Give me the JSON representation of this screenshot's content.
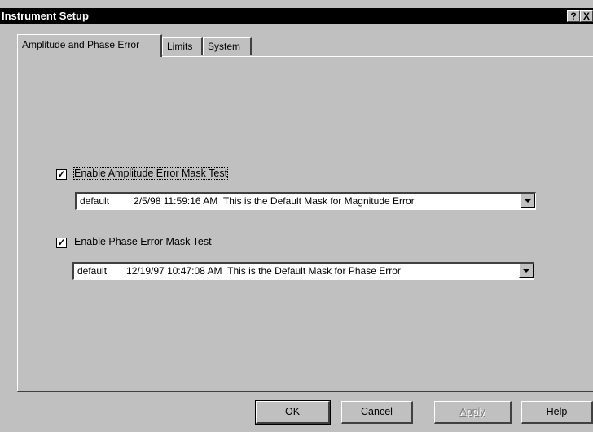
{
  "window": {
    "title": "Instrument Setup",
    "help_button": "?",
    "close_button": "X"
  },
  "tabs": [
    {
      "label": "Amplitude and Phase Error",
      "active": true
    },
    {
      "label": "Limits",
      "active": false
    },
    {
      "label": "System",
      "active": false
    }
  ],
  "amplitude": {
    "checkbox_label": "Enable Amplitude Error Mask Test",
    "checked": true,
    "check_glyph": "✓",
    "mask": {
      "name": "default",
      "timestamp": "2/5/98 11:59:16 AM",
      "description": "This is the Default Mask for Magnitude Error"
    }
  },
  "phase": {
    "checkbox_label": "Enable Phase Error Mask Test",
    "checked": true,
    "check_glyph": "✓",
    "mask": {
      "name": "default",
      "timestamp": "12/19/97 10:47:08 AM",
      "description": "This is the Default Mask for Phase Error"
    }
  },
  "buttons": {
    "ok": "OK",
    "cancel": "Cancel",
    "apply": "Apply",
    "help": "Help"
  }
}
